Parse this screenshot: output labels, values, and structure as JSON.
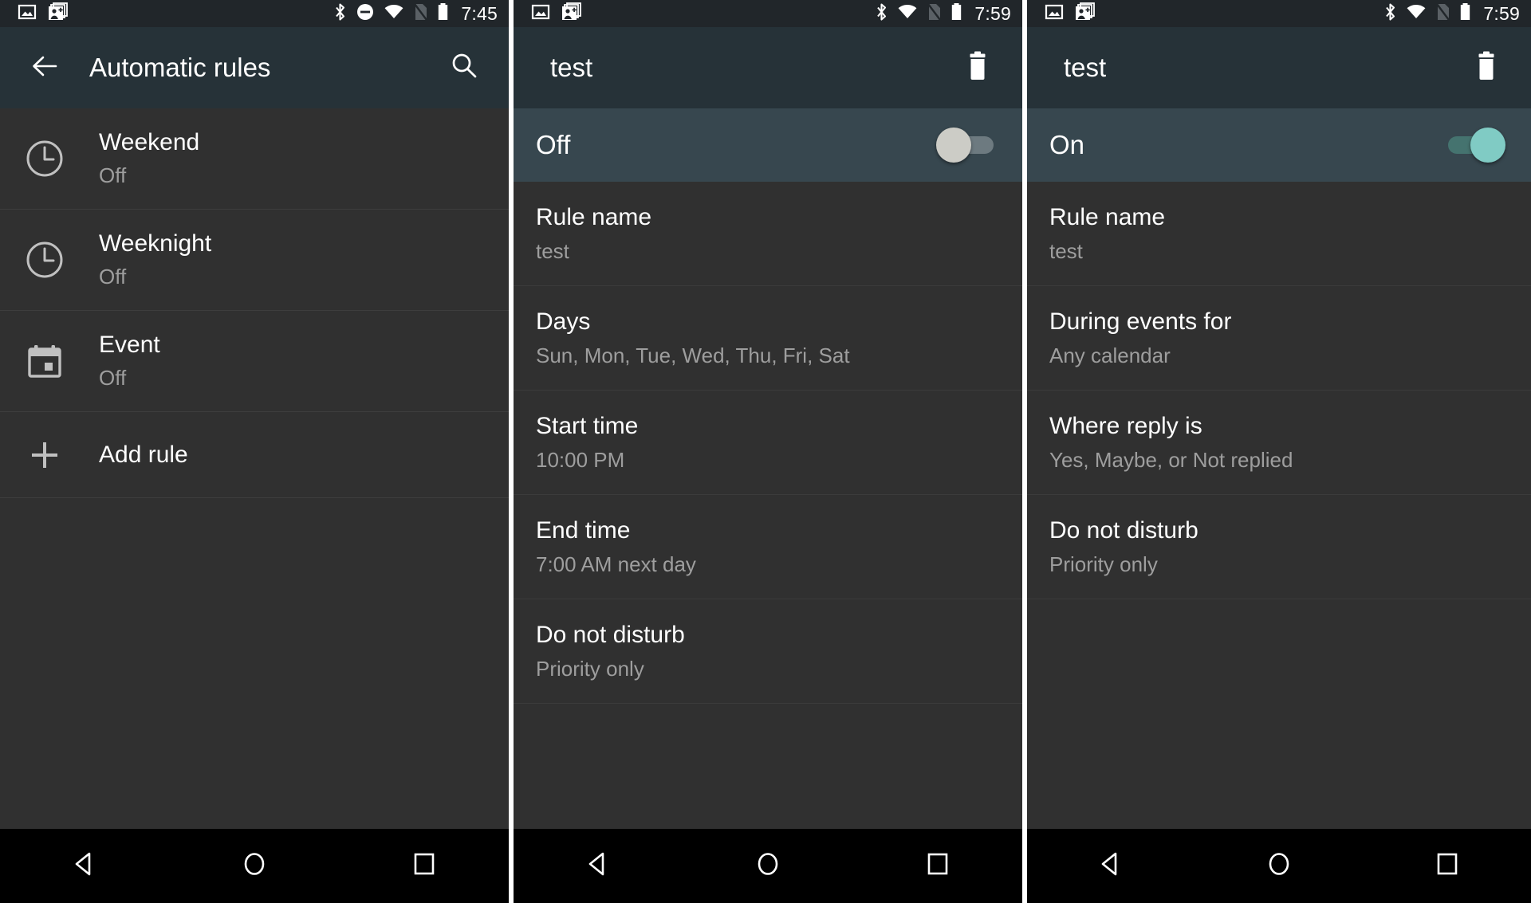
{
  "panels": [
    {
      "id": "automatic-rules",
      "statusbar": {
        "time": "7:45",
        "icons": [
          "photo-icon",
          "google-photos-add-icon",
          "bluetooth-icon",
          "do-not-disturb-icon",
          "wifi-icon",
          "no-sim-icon",
          "battery-icon"
        ]
      },
      "actionbar": {
        "title": "Automatic rules",
        "back_icon": "back-arrow-icon",
        "action_icon": "search-icon"
      },
      "rules": [
        {
          "icon": "clock-icon",
          "title": "Weekend",
          "subtitle": "Off"
        },
        {
          "icon": "clock-icon",
          "title": "Weeknight",
          "subtitle": "Off"
        },
        {
          "icon": "calendar-icon",
          "title": "Event",
          "subtitle": "Off"
        },
        {
          "icon": "plus-icon",
          "title": "Add rule",
          "subtitle": ""
        }
      ]
    },
    {
      "id": "rule-detail-off",
      "statusbar": {
        "time": "7:59",
        "icons": [
          "photo-icon",
          "google-photos-add-icon",
          "bluetooth-icon",
          "wifi-icon",
          "no-sim-icon",
          "battery-icon"
        ]
      },
      "actionbar": {
        "title": "test",
        "action_icon": "trash-icon"
      },
      "toggle": {
        "label": "Off",
        "state": "off"
      },
      "rows": [
        {
          "title": "Rule name",
          "subtitle": "test"
        },
        {
          "title": "Days",
          "subtitle": "Sun, Mon, Tue, Wed, Thu, Fri, Sat"
        },
        {
          "title": "Start time",
          "subtitle": "10:00 PM"
        },
        {
          "title": "End time",
          "subtitle": "7:00 AM next day"
        },
        {
          "title": "Do not disturb",
          "subtitle": "Priority only"
        }
      ]
    },
    {
      "id": "rule-detail-on",
      "statusbar": {
        "time": "7:59",
        "icons": [
          "photo-icon",
          "google-photos-add-icon",
          "bluetooth-icon",
          "wifi-icon",
          "no-sim-icon",
          "battery-icon"
        ]
      },
      "actionbar": {
        "title": "test",
        "action_icon": "trash-icon"
      },
      "toggle": {
        "label": "On",
        "state": "on"
      },
      "rows": [
        {
          "title": "Rule name",
          "subtitle": "test"
        },
        {
          "title": "During events for",
          "subtitle": "Any calendar"
        },
        {
          "title": "Where reply is",
          "subtitle": "Yes, Maybe, or Not replied"
        },
        {
          "title": "Do not disturb",
          "subtitle": "Priority only"
        }
      ]
    }
  ],
  "navbar": {
    "buttons": [
      {
        "icon": "back-triangle-icon",
        "name": "nav-back"
      },
      {
        "icon": "home-circle-icon",
        "name": "nav-home"
      },
      {
        "icon": "recents-square-icon",
        "name": "nav-recents"
      }
    ]
  },
  "colors": {
    "status_bar": "#21262a",
    "action_bar": "#263238",
    "toggle_row": "#37474f",
    "list_bg": "#303030",
    "nav_bar": "#000000",
    "accent_on": "#80cbc4",
    "thumb_off": "#ccccc6",
    "title_text": "#ffffff",
    "subtitle_text": "#9e9e9e"
  }
}
